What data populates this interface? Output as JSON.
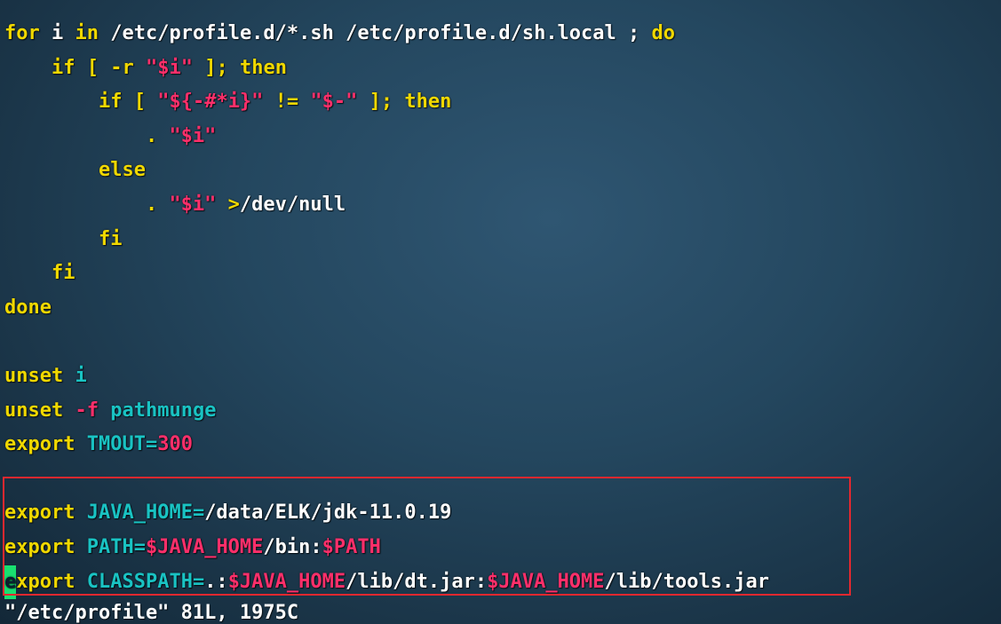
{
  "editor": {
    "lines": [
      [
        {
          "t": "for",
          "c": "kw"
        },
        {
          "t": " i ",
          "c": "wht"
        },
        {
          "t": "in",
          "c": "kw"
        },
        {
          "t": " /etc/profile.d/*.sh /etc/profile.d/sh.local ; ",
          "c": "wht"
        },
        {
          "t": "do",
          "c": "kw"
        }
      ],
      [
        {
          "t": "    ",
          "c": "wht"
        },
        {
          "t": "if",
          "c": "kw"
        },
        {
          "t": " [ -r ",
          "c": "kw"
        },
        {
          "t": "\"",
          "c": "str"
        },
        {
          "t": "$i",
          "c": "var"
        },
        {
          "t": "\"",
          "c": "str"
        },
        {
          "t": " ]; ",
          "c": "kw"
        },
        {
          "t": "then",
          "c": "kw"
        }
      ],
      [
        {
          "t": "        ",
          "c": "wht"
        },
        {
          "t": "if",
          "c": "kw"
        },
        {
          "t": " [ ",
          "c": "kw"
        },
        {
          "t": "\"${-#*i}\"",
          "c": "str"
        },
        {
          "t": " != ",
          "c": "kw"
        },
        {
          "t": "\"$-\"",
          "c": "str"
        },
        {
          "t": " ]; ",
          "c": "kw"
        },
        {
          "t": "then",
          "c": "kw"
        }
      ],
      [
        {
          "t": "            . ",
          "c": "kw"
        },
        {
          "t": "\"$i\"",
          "c": "str"
        }
      ],
      [
        {
          "t": "        ",
          "c": "wht"
        },
        {
          "t": "else",
          "c": "kw"
        }
      ],
      [
        {
          "t": "            . ",
          "c": "kw"
        },
        {
          "t": "\"$i\"",
          "c": "str"
        },
        {
          "t": " >",
          "c": "kw"
        },
        {
          "t": "/dev/null",
          "c": "wht"
        }
      ],
      [
        {
          "t": "        ",
          "c": "wht"
        },
        {
          "t": "fi",
          "c": "kw"
        }
      ],
      [
        {
          "t": "    ",
          "c": "wht"
        },
        {
          "t": "fi",
          "c": "kw"
        }
      ],
      [
        {
          "t": "done",
          "c": "kw"
        }
      ],
      [],
      [
        {
          "t": "unset",
          "c": "kw"
        },
        {
          "t": " ",
          "c": "wht"
        },
        {
          "t": "i",
          "c": "cyn"
        }
      ],
      [
        {
          "t": "unset",
          "c": "kw"
        },
        {
          "t": " ",
          "c": "wht"
        },
        {
          "t": "-f",
          "c": "str"
        },
        {
          "t": " ",
          "c": "wht"
        },
        {
          "t": "pathmunge",
          "c": "cyn"
        }
      ],
      [
        {
          "t": "export",
          "c": "kw"
        },
        {
          "t": " ",
          "c": "wht"
        },
        {
          "t": "TMOUT=",
          "c": "cyn"
        },
        {
          "t": "300",
          "c": "str"
        }
      ],
      [],
      [
        {
          "t": "export",
          "c": "kw"
        },
        {
          "t": " ",
          "c": "wht"
        },
        {
          "t": "JAVA_HOME=",
          "c": "cyn"
        },
        {
          "t": "/data/ELK/jdk-11.0.19",
          "c": "wht"
        }
      ],
      [
        {
          "t": "export",
          "c": "kw"
        },
        {
          "t": " ",
          "c": "wht"
        },
        {
          "t": "PATH=",
          "c": "cyn"
        },
        {
          "t": "$JAVA_HOME",
          "c": "var"
        },
        {
          "t": "/bin:",
          "c": "wht"
        },
        {
          "t": "$PATH",
          "c": "var"
        }
      ],
      [
        {
          "t": "xport",
          "c": "kw",
          "cursor": "e"
        },
        {
          "t": " ",
          "c": "wht"
        },
        {
          "t": "CLASSPATH=",
          "c": "cyn"
        },
        {
          "t": ".:",
          "c": "wht"
        },
        {
          "t": "$JAVA_HOME",
          "c": "var"
        },
        {
          "t": "/lib/dt.jar:",
          "c": "wht"
        },
        {
          "t": "$JAVA_HOME",
          "c": "var"
        },
        {
          "t": "/lib/tools.jar",
          "c": "wht"
        }
      ]
    ],
    "status_line": "\"/etc/profile\" 81L, 1975C",
    "highlight_color": "#e3282f",
    "cursor_color": "#19e070"
  }
}
